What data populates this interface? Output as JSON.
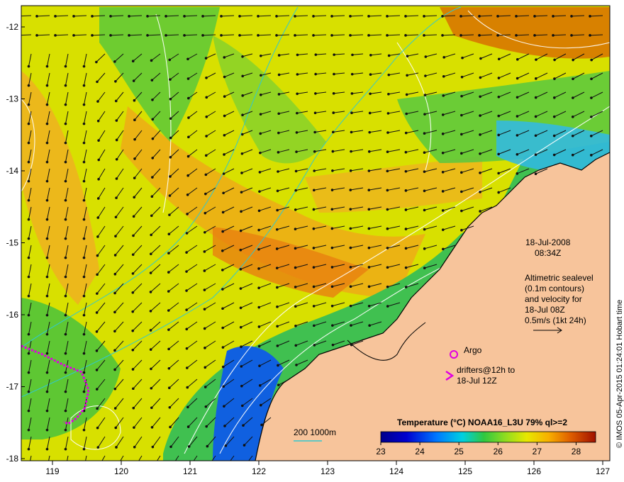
{
  "map": {
    "lon_ticks": [
      "119",
      "120",
      "121",
      "122",
      "123",
      "124",
      "125",
      "126",
      "127"
    ],
    "lat_ticks": [
      "-12",
      "-13",
      "-14",
      "-15",
      "-16",
      "-17",
      "-18"
    ]
  },
  "annotation": {
    "date": "18-Jul-2008",
    "time": "08:34Z",
    "altimetry_lines": [
      "Altimetric sealevel",
      "(0.1m contours)",
      "and velocity for",
      "18-Jul 08Z",
      "0.5m/s (1kt 24h)"
    ],
    "argo_label": "Argo",
    "drifters_line1": "drifters@12h to",
    "drifters_line2": "18-Jul 12Z",
    "depth_scale": "200  1000m",
    "credit": "© IMOS 05-Apr-2015 01:24:01 Hobart time"
  },
  "colorbar": {
    "title": "Temperature (°C) NOAA16_L3U 79% ql>=2",
    "ticks": [
      "23",
      "24",
      "25",
      "26",
      "27",
      "28"
    ],
    "range": [
      23,
      28.5
    ]
  },
  "colors": {
    "land": "#f7c49b",
    "argo": "#e000e0",
    "drifter": "#e000e0",
    "contour": "#ffffff",
    "isobath": "#30c8d0"
  }
}
